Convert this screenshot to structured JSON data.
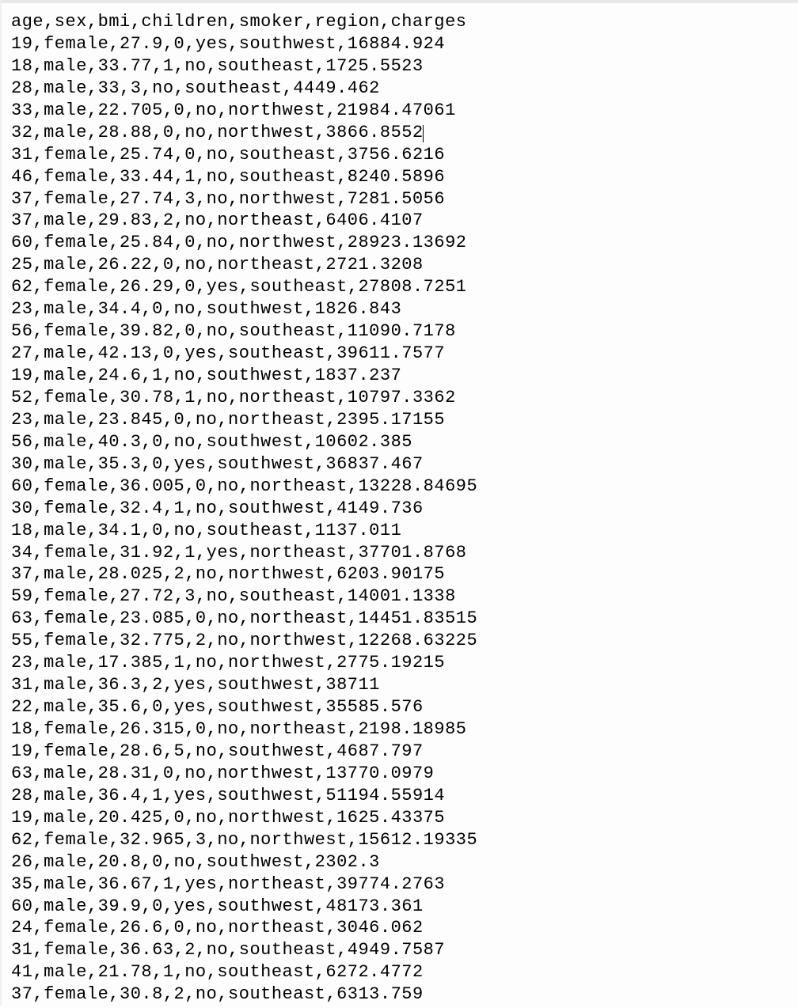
{
  "header": "age,sex,bmi,children,smoker,region,charges",
  "cursor_line_index": 5,
  "rows": [
    "19,female,27.9,0,yes,southwest,16884.924",
    "18,male,33.77,1,no,southeast,1725.5523",
    "28,male,33,3,no,southeast,4449.462",
    "33,male,22.705,0,no,northwest,21984.47061",
    "32,male,28.88,0,no,northwest,3866.8552",
    "31,female,25.74,0,no,southeast,3756.6216",
    "46,female,33.44,1,no,southeast,8240.5896",
    "37,female,27.74,3,no,northwest,7281.5056",
    "37,male,29.83,2,no,northeast,6406.4107",
    "60,female,25.84,0,no,northwest,28923.13692",
    "25,male,26.22,0,no,northeast,2721.3208",
    "62,female,26.29,0,yes,southeast,27808.7251",
    "23,male,34.4,0,no,southwest,1826.843",
    "56,female,39.82,0,no,southeast,11090.7178",
    "27,male,42.13,0,yes,southeast,39611.7577",
    "19,male,24.6,1,no,southwest,1837.237",
    "52,female,30.78,1,no,northeast,10797.3362",
    "23,male,23.845,0,no,northeast,2395.17155",
    "56,male,40.3,0,no,southwest,10602.385",
    "30,male,35.3,0,yes,southwest,36837.467",
    "60,female,36.005,0,no,northeast,13228.84695",
    "30,female,32.4,1,no,southwest,4149.736",
    "18,male,34.1,0,no,southeast,1137.011",
    "34,female,31.92,1,yes,northeast,37701.8768",
    "37,male,28.025,2,no,northwest,6203.90175",
    "59,female,27.72,3,no,southeast,14001.1338",
    "63,female,23.085,0,no,northeast,14451.83515",
    "55,female,32.775,2,no,northwest,12268.63225",
    "23,male,17.385,1,no,northwest,2775.19215",
    "31,male,36.3,2,yes,southwest,38711",
    "22,male,35.6,0,yes,southwest,35585.576",
    "18,female,26.315,0,no,northeast,2198.18985",
    "19,female,28.6,5,no,southwest,4687.797",
    "63,male,28.31,0,no,northwest,13770.0979",
    "28,male,36.4,1,yes,southwest,51194.55914",
    "19,male,20.425,0,no,northwest,1625.43375",
    "62,female,32.965,3,no,northwest,15612.19335",
    "26,male,20.8,0,no,southwest,2302.3",
    "35,male,36.67,1,yes,northeast,39774.2763",
    "60,male,39.9,0,yes,southwest,48173.361",
    "24,female,26.6,0,no,northeast,3046.062",
    "31,female,36.63,2,no,southeast,4949.7587",
    "41,male,21.78,1,no,southeast,6272.4772",
    "37,female,30.8,2,no,southeast,6313.759"
  ]
}
